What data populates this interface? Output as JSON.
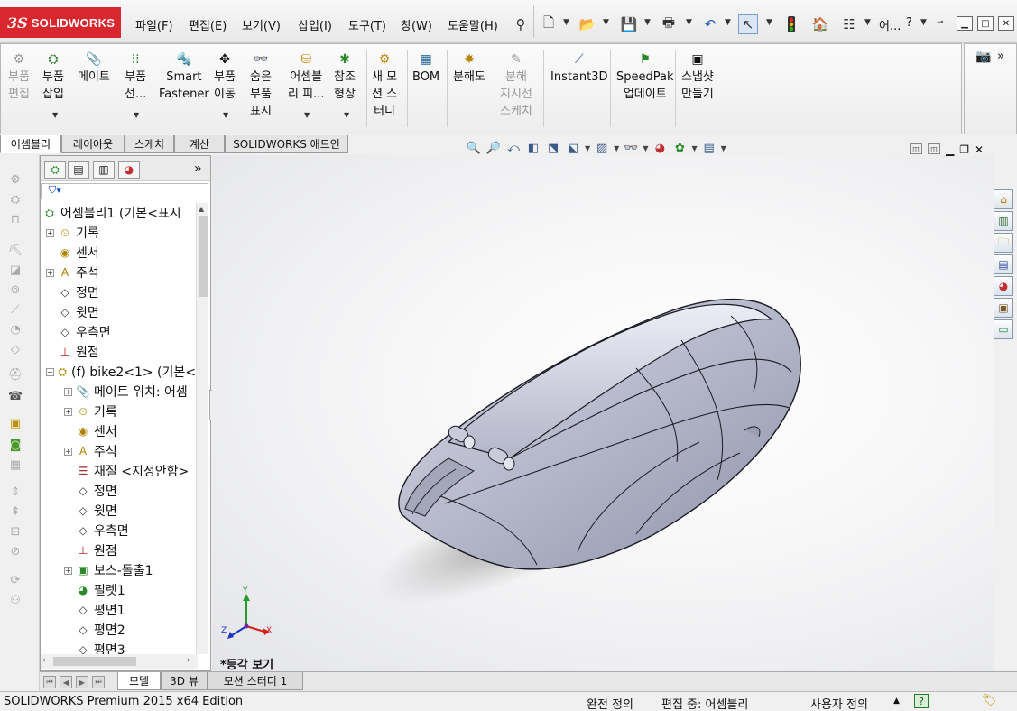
{
  "app": {
    "logo_ds": "3S",
    "logo_name": "SOLIDWORKS",
    "menus": [
      "파일(F)",
      "편집(E)",
      "보기(V)",
      "삽입(I)",
      "도구(T)",
      "창(W)",
      "도움말(H)"
    ],
    "search_short": "어...",
    "help_q": "?"
  },
  "commands": [
    {
      "label": "부품\n편집",
      "icon": "edit-component-icon",
      "disabled": true
    },
    {
      "label": "부품\n삽입",
      "icon": "insert-components-icon",
      "disabled": false
    },
    {
      "label": "메이트",
      "icon": "mate-icon",
      "disabled": false
    },
    {
      "label": "부품\n선...",
      "icon": "linear-pattern-icon",
      "disabled": false
    },
    {
      "label": "Smart\nFastener",
      "icon": "smart-fastener-icon",
      "disabled": false
    },
    {
      "label": "부품\n이동",
      "icon": "move-component-icon",
      "disabled": false
    },
    {
      "label": "숨은\n부품\n표시",
      "icon": "show-hidden-icon",
      "disabled": false
    },
    {
      "label": "어셈블\n리 피...",
      "icon": "assembly-features-icon",
      "disabled": false
    },
    {
      "label": "참조\n형상",
      "icon": "reference-geometry-icon",
      "disabled": false
    },
    {
      "label": "새 모\n션 스\n터디",
      "icon": "new-motion-study-icon",
      "disabled": false
    },
    {
      "label": "BOM",
      "icon": "bom-icon",
      "disabled": false
    },
    {
      "label": "분해도",
      "icon": "exploded-view-icon",
      "disabled": false
    },
    {
      "label": "분해\n지시선\n스케치",
      "icon": "explode-line-sketch-icon",
      "disabled": true
    },
    {
      "label": "Instant3D",
      "icon": "instant3d-icon",
      "disabled": false
    },
    {
      "label": "SpeedPak\n업데이트",
      "icon": "speedpak-icon",
      "disabled": false
    },
    {
      "label": "스냅샷\n만들기",
      "icon": "snapshot-icon",
      "disabled": false
    }
  ],
  "tabs": [
    "어셈블리",
    "레이아웃",
    "스케치",
    "계산",
    "SOLIDWORKS 애드인"
  ],
  "tree": [
    {
      "label": "어셈블리1  (기본<표시",
      "icon": "assembly-icon",
      "level": 0,
      "expander": ""
    },
    {
      "label": "기록",
      "icon": "history-icon",
      "level": 1,
      "expander": "+"
    },
    {
      "label": "센서",
      "icon": "sensor-icon",
      "level": 1,
      "expander": ""
    },
    {
      "label": "주석",
      "icon": "annotation-icon",
      "level": 1,
      "expander": "+"
    },
    {
      "label": "정면",
      "icon": "plane-icon",
      "level": 1,
      "expander": ""
    },
    {
      "label": "윗면",
      "icon": "plane-icon",
      "level": 1,
      "expander": ""
    },
    {
      "label": "우측면",
      "icon": "plane-icon",
      "level": 1,
      "expander": ""
    },
    {
      "label": "원점",
      "icon": "origin-icon",
      "level": 1,
      "expander": ""
    },
    {
      "label": "(f) bike2<1> (기본<",
      "icon": "part-icon",
      "level": 1,
      "expander": "−"
    },
    {
      "label": "메이트 위치: 어셈",
      "icon": "mate-folder-icon",
      "level": 2,
      "expander": "+"
    },
    {
      "label": "기록",
      "icon": "history-icon",
      "level": 2,
      "expander": "+"
    },
    {
      "label": "센서",
      "icon": "sensor-icon",
      "level": 2,
      "expander": ""
    },
    {
      "label": "주석",
      "icon": "annotation-icon",
      "level": 2,
      "expander": "+"
    },
    {
      "label": "재질 <지정안함>",
      "icon": "material-icon",
      "level": 2,
      "expander": ""
    },
    {
      "label": "정면",
      "icon": "plane-icon",
      "level": 2,
      "expander": ""
    },
    {
      "label": "윗면",
      "icon": "plane-icon",
      "level": 2,
      "expander": ""
    },
    {
      "label": "우측면",
      "icon": "plane-icon",
      "level": 2,
      "expander": ""
    },
    {
      "label": "원점",
      "icon": "origin-icon",
      "level": 2,
      "expander": ""
    },
    {
      "label": "보스-돌출1",
      "icon": "extrude-icon",
      "level": 2,
      "expander": "+"
    },
    {
      "label": "필렛1",
      "icon": "fillet-icon",
      "level": 2,
      "expander": ""
    },
    {
      "label": "평면1",
      "icon": "plane-icon",
      "level": 2,
      "expander": ""
    },
    {
      "label": "평면2",
      "icon": "plane-icon",
      "level": 2,
      "expander": ""
    },
    {
      "label": "평면3",
      "icon": "plane-icon",
      "level": 2,
      "expander": ""
    }
  ],
  "bottom_tabs": [
    "모델",
    "3D 뷰",
    "모션 스터디 1"
  ],
  "viewport": {
    "view_name": "*등각 보기",
    "triad": {
      "x": "X",
      "y": "Y",
      "z": "Z"
    }
  },
  "status": {
    "edition": "SOLIDWORKS Premium 2015 x64 Edition",
    "state": "완전 정의",
    "editing": "편집 중: 어셈블리",
    "custom": "사용자 정의"
  },
  "colors": {
    "brand_red": "#d8272f",
    "model_body": "#b9bbd0",
    "model_edge": "#1b1b24"
  }
}
